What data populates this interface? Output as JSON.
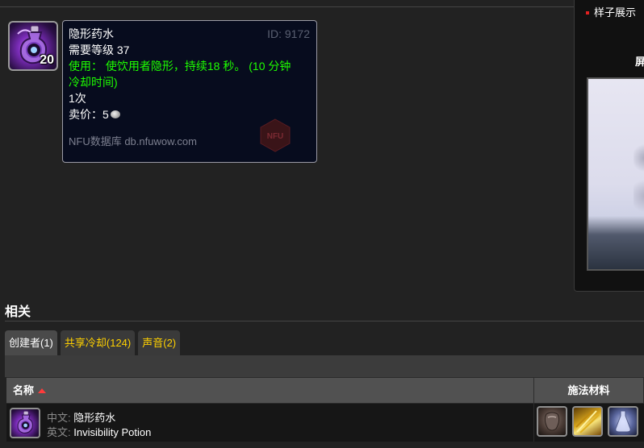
{
  "sidebar": {
    "link_label": "样子展示",
    "heading": "屏"
  },
  "item": {
    "stack_count": "20",
    "icon": "invisibility-potion-icon"
  },
  "tooltip": {
    "name": "隐形药水",
    "id_label": "ID: 9172",
    "required_level": "需要等级 37",
    "use_line1": "使用： 使饮用者隐形，持续18 秒。 (10 分钟",
    "use_line2": "冷却时间)",
    "charges": "1次",
    "sell_price": "卖价：5",
    "source": "NFU数据库 db.nfuwow.com",
    "logo_text": "NFU",
    "colors": {
      "use_text": "#1eff00",
      "id_text": "#5a6072"
    }
  },
  "related": {
    "title": "相关",
    "tabs": [
      {
        "label": "创建者(1)",
        "active": true
      },
      {
        "label": "共享冷却(124)",
        "active": false
      },
      {
        "label": "声音(2)",
        "active": false
      }
    ],
    "table": {
      "columns": {
        "name": "名称",
        "reagents": "施法材料"
      },
      "rows": [
        {
          "cn_label": "中文:",
          "cn_value": "隐形药水",
          "en_label": "英文:",
          "en_value": "Invisibility Potion",
          "reagents": [
            "reagent-1-icon",
            "reagent-2-icon",
            "reagent-3-icon"
          ]
        }
      ]
    }
  },
  "colors": {
    "tab_link": "#ffd100",
    "background": "#222222"
  }
}
